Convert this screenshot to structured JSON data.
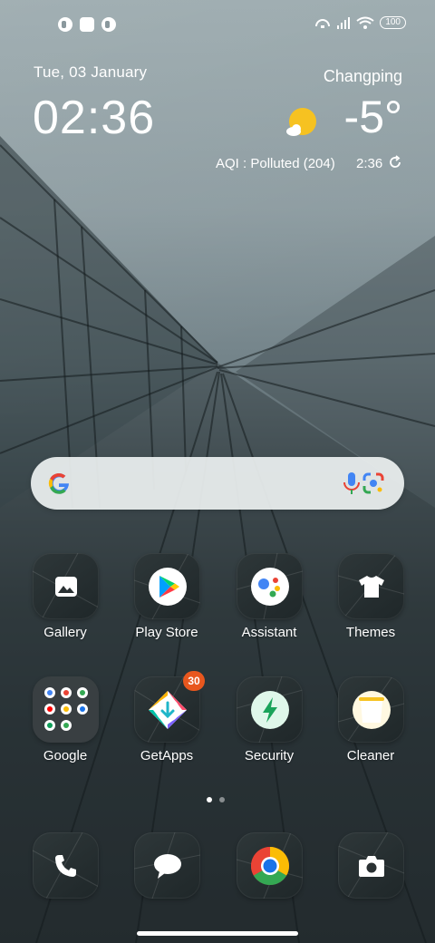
{
  "status_bar": {
    "battery": "100",
    "left_icons": [
      "notification-icon",
      "square-notification-icon",
      "notification-icon"
    ],
    "right_icons": [
      "hotspot-icon",
      "signal-icon",
      "wifi-icon",
      "battery-icon"
    ]
  },
  "widget": {
    "date": "Tue, 03 January",
    "time": "02:36",
    "city": "Changping",
    "temperature": "-5°",
    "aqi": "AQI : Polluted (204)",
    "weather_time": "2:36",
    "weather_icon": "partly-cloudy-icon"
  },
  "search": {
    "icons": [
      "google-logo-icon",
      "mic-icon",
      "lens-icon"
    ]
  },
  "apps": [
    {
      "label": "Gallery",
      "icon": "gallery-icon"
    },
    {
      "label": "Play Store",
      "icon": "play-store-icon"
    },
    {
      "label": "Assistant",
      "icon": "assistant-icon"
    },
    {
      "label": "Themes",
      "icon": "themes-icon"
    },
    {
      "label": "Google",
      "icon": "google-folder-icon"
    },
    {
      "label": "GetApps",
      "icon": "getapps-icon",
      "badge": "30"
    },
    {
      "label": "Security",
      "icon": "security-icon"
    },
    {
      "label": "Cleaner",
      "icon": "cleaner-icon"
    }
  ],
  "dock": [
    {
      "name": "Phone",
      "icon": "phone-icon"
    },
    {
      "name": "Messages",
      "icon": "messages-icon"
    },
    {
      "name": "Chrome",
      "icon": "chrome-icon"
    },
    {
      "name": "Camera",
      "icon": "camera-icon"
    }
  ],
  "page_indicator": {
    "pages": 2,
    "current": 1
  },
  "colors": {
    "badge": "#e8571e",
    "weather_sun": "#f6c221",
    "security_accent": "#1aa35a"
  }
}
